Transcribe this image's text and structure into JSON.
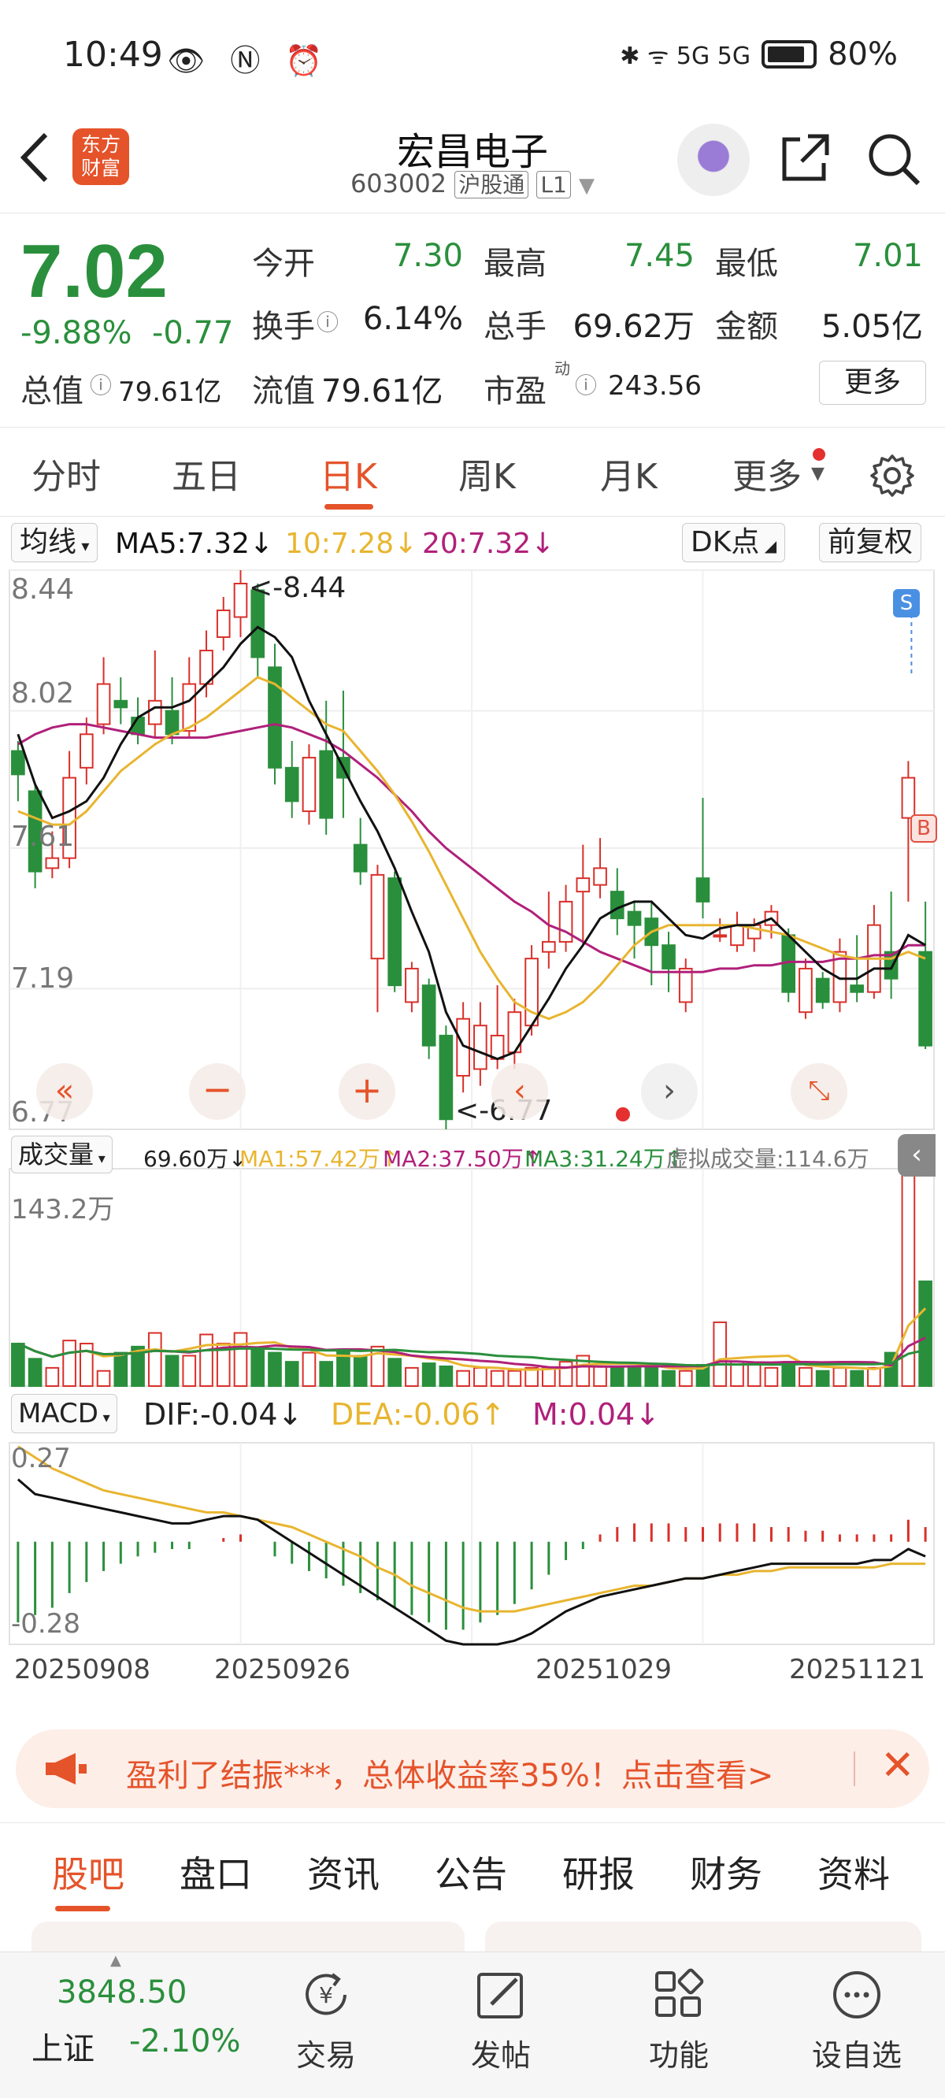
{
  "status_bar": {
    "time": "10:49",
    "left_icons": "👁 Ⓝ ⏰",
    "network": "✱ ᯤ 5G 5G",
    "battery": "80%"
  },
  "header": {
    "back_icon": "chevron-left-icon",
    "logo_text_1": "东方",
    "logo_text_2": "财富",
    "title": "宏昌电子",
    "code": "603002",
    "market_tag": "沪股通",
    "level_tag": "L1",
    "dropdown_arrow": "▼"
  },
  "quote": {
    "price": "7.02",
    "change_pct": "-9.88%",
    "change_amt": "-0.77",
    "rows": [
      [
        {
          "label": "今开",
          "value": "7.30",
          "color": "green"
        },
        {
          "label": "最高",
          "value": "7.45",
          "color": "green"
        },
        {
          "label": "最低",
          "value": "7.01",
          "color": "green"
        }
      ],
      [
        {
          "label": "换手",
          "value": "6.14%",
          "color": "dark"
        },
        {
          "label": "总手",
          "value": "69.62万",
          "color": "dark"
        },
        {
          "label": "金额",
          "value": "5.05亿",
          "color": "dark"
        }
      ],
      [
        {
          "label": "总值",
          "value": "79.61亿",
          "color": "dark"
        },
        {
          "label": "流值",
          "value": "79.61亿",
          "color": "dark"
        },
        {
          "label": "市盈",
          "value": "243.56",
          "color": "dark"
        }
      ]
    ],
    "pe_superscript": "动",
    "more_label": "更多"
  },
  "chart_tabs": [
    "分时",
    "五日",
    "日K",
    "周K",
    "月K",
    "更多"
  ],
  "chart_tabs_active": "日K",
  "ma_bar": {
    "mode_label": "均线",
    "ma5": "MA5:7.32↓",
    "ma10": "10:7.28↓",
    "ma20": "20:7.32↓",
    "dk_label": "DK点",
    "adjust_label": "前复权"
  },
  "kline": {
    "y_labels": [
      "8.44",
      "8.02",
      "7.61",
      "7.19",
      "6.77"
    ],
    "high_marker": "<-8.44",
    "low_marker": "<-6.77",
    "s_badge": "S",
    "b_badge": "B"
  },
  "volume": {
    "mode_label": "成交量",
    "vol": "69.60万↓",
    "ma1": "MA1:57.42万↑",
    "ma2": "MA2:37.50万↑",
    "ma3": "MA3:31.24万↑",
    "virtual": "虚拟成交量:114.6万",
    "max_label": "143.2万"
  },
  "macd": {
    "mode_label": "MACD",
    "dif": "DIF:-0.04↓",
    "dea": "DEA:-0.06↑",
    "m": "M:0.04↓",
    "top_label": "0.27",
    "bottom_label": "-0.28"
  },
  "x_dates": [
    "20250908",
    "20250926",
    "20251029",
    "20251121"
  ],
  "ad": {
    "text": "盈利了结振***，总体收益率35%！点击查看>",
    "icon": "megaphone-icon"
  },
  "bottom_tabs": [
    "股吧",
    "盘口",
    "资讯",
    "公告",
    "研报",
    "财务",
    "资料"
  ],
  "bottom_tabs_active": "股吧",
  "nav": {
    "index_value": "3848.50",
    "index_name": "上证",
    "index_change": "-2.10%",
    "items": [
      "交易",
      "发帖",
      "功能",
      "设自选"
    ]
  },
  "colors": {
    "up": "#d9302a",
    "down": "#2a8f3c",
    "accent": "#e5532a",
    "ma5": "#111111",
    "ma10": "#e8b530",
    "ma20": "#b0207a"
  },
  "chart_data": {
    "type": "candlestick",
    "ylim": [
      6.77,
      8.44
    ],
    "candles": [
      {
        "o": 7.9,
        "c": 7.83,
        "h": 7.93,
        "l": 7.75
      },
      {
        "o": 7.78,
        "c": 7.54,
        "h": 7.8,
        "l": 7.49
      },
      {
        "o": 7.55,
        "c": 7.58,
        "h": 7.66,
        "l": 7.52
      },
      {
        "o": 7.58,
        "c": 7.82,
        "h": 7.9,
        "l": 7.55
      },
      {
        "o": 7.85,
        "c": 7.95,
        "h": 8.0,
        "l": 7.8
      },
      {
        "o": 7.98,
        "c": 8.1,
        "h": 8.18,
        "l": 7.95
      },
      {
        "o": 8.05,
        "c": 8.03,
        "h": 8.12,
        "l": 7.98
      },
      {
        "o": 8.0,
        "c": 7.95,
        "h": 8.06,
        "l": 7.92
      },
      {
        "o": 7.98,
        "c": 8.05,
        "h": 8.2,
        "l": 7.94
      },
      {
        "o": 8.02,
        "c": 7.95,
        "h": 8.12,
        "l": 7.92
      },
      {
        "o": 7.96,
        "c": 8.1,
        "h": 8.18,
        "l": 7.94
      },
      {
        "o": 8.1,
        "c": 8.2,
        "h": 8.26,
        "l": 8.06
      },
      {
        "o": 8.24,
        "c": 8.32,
        "h": 8.36,
        "l": 8.2
      },
      {
        "o": 8.3,
        "c": 8.4,
        "h": 8.44,
        "l": 8.24
      },
      {
        "o": 8.38,
        "c": 8.18,
        "h": 8.4,
        "l": 8.12
      },
      {
        "o": 8.15,
        "c": 7.85,
        "h": 8.22,
        "l": 7.8
      },
      {
        "o": 7.85,
        "c": 7.75,
        "h": 7.93,
        "l": 7.7
      },
      {
        "o": 7.72,
        "c": 7.88,
        "h": 7.92,
        "l": 7.68
      },
      {
        "o": 7.9,
        "c": 7.7,
        "h": 8.05,
        "l": 7.65
      },
      {
        "o": 7.88,
        "c": 7.82,
        "h": 8.08,
        "l": 7.7
      },
      {
        "o": 7.62,
        "c": 7.54,
        "h": 7.7,
        "l": 7.5
      },
      {
        "o": 7.28,
        "c": 7.53,
        "h": 7.56,
        "l": 7.12
      },
      {
        "o": 7.52,
        "c": 7.2,
        "h": 7.54,
        "l": 7.18
      },
      {
        "o": 7.15,
        "c": 7.25,
        "h": 7.27,
        "l": 7.12
      },
      {
        "o": 7.2,
        "c": 7.02,
        "h": 7.22,
        "l": 6.98
      },
      {
        "o": 7.05,
        "c": 6.8,
        "h": 7.08,
        "l": 6.77
      },
      {
        "o": 6.93,
        "c": 7.1,
        "h": 7.15,
        "l": 6.88
      },
      {
        "o": 6.95,
        "c": 7.08,
        "h": 7.15,
        "l": 6.9
      },
      {
        "o": 6.98,
        "c": 7.05,
        "h": 7.2,
        "l": 6.95
      },
      {
        "o": 7.0,
        "c": 7.12,
        "h": 7.16,
        "l": 6.95
      },
      {
        "o": 7.08,
        "c": 7.28,
        "h": 7.32,
        "l": 7.05
      },
      {
        "o": 7.3,
        "c": 7.33,
        "h": 7.48,
        "l": 7.25
      },
      {
        "o": 7.33,
        "c": 7.45,
        "h": 7.5,
        "l": 7.3
      },
      {
        "o": 7.48,
        "c": 7.52,
        "h": 7.62,
        "l": 7.32
      },
      {
        "o": 7.5,
        "c": 7.55,
        "h": 7.64,
        "l": 7.46
      },
      {
        "o": 7.48,
        "c": 7.4,
        "h": 7.55,
        "l": 7.35
      },
      {
        "o": 7.42,
        "c": 7.38,
        "h": 7.45,
        "l": 7.28
      },
      {
        "o": 7.4,
        "c": 7.32,
        "h": 7.45,
        "l": 7.2
      },
      {
        "o": 7.32,
        "c": 7.25,
        "h": 7.36,
        "l": 7.18
      },
      {
        "o": 7.15,
        "c": 7.25,
        "h": 7.28,
        "l": 7.12
      },
      {
        "o": 7.52,
        "c": 7.45,
        "h": 7.76,
        "l": 7.4
      },
      {
        "o": 7.35,
        "c": 7.35,
        "h": 7.4,
        "l": 7.33
      },
      {
        "o": 7.32,
        "c": 7.38,
        "h": 7.42,
        "l": 7.3
      },
      {
        "o": 7.34,
        "c": 7.38,
        "h": 7.4,
        "l": 7.3
      },
      {
        "o": 7.38,
        "c": 7.42,
        "h": 7.44,
        "l": 7.34
      },
      {
        "o": 7.35,
        "c": 7.18,
        "h": 7.37,
        "l": 7.15
      },
      {
        "o": 7.12,
        "c": 7.25,
        "h": 7.28,
        "l": 7.1
      },
      {
        "o": 7.22,
        "c": 7.15,
        "h": 7.24,
        "l": 7.13
      },
      {
        "o": 7.15,
        "c": 7.3,
        "h": 7.34,
        "l": 7.12
      },
      {
        "o": 7.2,
        "c": 7.18,
        "h": 7.35,
        "l": 7.15
      },
      {
        "o": 7.18,
        "c": 7.38,
        "h": 7.44,
        "l": 7.16
      },
      {
        "o": 7.3,
        "c": 7.22,
        "h": 7.48,
        "l": 7.16
      },
      {
        "o": 7.7,
        "c": 7.82,
        "h": 7.87,
        "l": 7.45
      },
      {
        "o": 7.3,
        "c": 7.02,
        "h": 7.45,
        "l": 7.01
      }
    ],
    "ma5": [
      7.95,
      7.8,
      7.7,
      7.72,
      7.75,
      7.82,
      7.92,
      8.0,
      8.03,
      8.03,
      8.05,
      8.1,
      8.15,
      8.22,
      8.27,
      8.24,
      8.18,
      8.05,
      7.95,
      7.85,
      7.75,
      7.66,
      7.55,
      7.42,
      7.3,
      7.12,
      7.02,
      7.0,
      6.98,
      7.0,
      7.08,
      7.16,
      7.25,
      7.32,
      7.4,
      7.43,
      7.45,
      7.45,
      7.4,
      7.35,
      7.34,
      7.37,
      7.38,
      7.38,
      7.4,
      7.35,
      7.3,
      7.25,
      7.22,
      7.22,
      7.25,
      7.25,
      7.35,
      7.32
    ],
    "ma10": [
      7.72,
      7.7,
      7.68,
      7.68,
      7.72,
      7.78,
      7.84,
      7.88,
      7.92,
      7.95,
      7.97,
      8.0,
      8.04,
      8.08,
      8.12,
      8.1,
      8.06,
      8.02,
      7.98,
      7.96,
      7.9,
      7.84,
      7.77,
      7.69,
      7.6,
      7.5,
      7.4,
      7.3,
      7.22,
      7.15,
      7.12,
      7.1,
      7.12,
      7.15,
      7.2,
      7.26,
      7.32,
      7.36,
      7.38,
      7.38,
      7.38,
      7.38,
      7.38,
      7.37,
      7.36,
      7.35,
      7.33,
      7.31,
      7.29,
      7.28,
      7.28,
      7.28,
      7.3,
      7.28
    ],
    "ma20": [
      7.92,
      7.95,
      7.97,
      7.98,
      7.98,
      7.97,
      7.96,
      7.95,
      7.94,
      7.94,
      7.94,
      7.94,
      7.95,
      7.96,
      7.97,
      7.98,
      7.97,
      7.95,
      7.93,
      7.9,
      7.86,
      7.82,
      7.77,
      7.72,
      7.66,
      7.61,
      7.57,
      7.53,
      7.49,
      7.45,
      7.42,
      7.38,
      7.36,
      7.33,
      7.3,
      7.28,
      7.26,
      7.24,
      7.24,
      7.24,
      7.24,
      7.25,
      7.25,
      7.26,
      7.26,
      7.27,
      7.27,
      7.27,
      7.28,
      7.28,
      7.29,
      7.29,
      7.32,
      7.32
    ],
    "volume": [
      28,
      18,
      12,
      30,
      28,
      10,
      22,
      26,
      35,
      20,
      20,
      34,
      28,
      35,
      25,
      22,
      16,
      22,
      16,
      24,
      20,
      26,
      18,
      12,
      15,
      13,
      10,
      12,
      10,
      10,
      12,
      12,
      16,
      20,
      13,
      13,
      12,
      12,
      10,
      10,
      14,
      42,
      16,
      14,
      12,
      16,
      12,
      10,
      12,
      10,
      12,
      22,
      143,
      69
    ],
    "volume_ylim": [
      0,
      143.2
    ],
    "macd_hist": [
      -0.22,
      -0.2,
      -0.18,
      -0.14,
      -0.11,
      -0.08,
      -0.06,
      -0.04,
      -0.03,
      -0.02,
      -0.02,
      0.0,
      0.01,
      0.02,
      0.0,
      -0.04,
      -0.06,
      -0.08,
      -0.1,
      -0.12,
      -0.14,
      -0.16,
      -0.18,
      -0.2,
      -0.22,
      -0.24,
      -0.24,
      -0.22,
      -0.2,
      -0.17,
      -0.13,
      -0.09,
      -0.05,
      -0.02,
      0.02,
      0.04,
      0.05,
      0.05,
      0.05,
      0.04,
      0.04,
      0.05,
      0.05,
      0.05,
      0.04,
      0.04,
      0.03,
      0.03,
      0.02,
      0.02,
      0.02,
      0.02,
      0.06,
      0.04
    ],
    "dif": [
      0.17,
      0.13,
      0.12,
      0.11,
      0.1,
      0.09,
      0.08,
      0.07,
      0.06,
      0.05,
      0.05,
      0.06,
      0.07,
      0.07,
      0.06,
      0.03,
      0.0,
      -0.03,
      -0.06,
      -0.09,
      -0.12,
      -0.15,
      -0.18,
      -0.21,
      -0.24,
      -0.27,
      -0.28,
      -0.28,
      -0.28,
      -0.27,
      -0.25,
      -0.22,
      -0.19,
      -0.17,
      -0.15,
      -0.14,
      -0.13,
      -0.12,
      -0.11,
      -0.1,
      -0.1,
      -0.09,
      -0.08,
      -0.07,
      -0.06,
      -0.06,
      -0.06,
      -0.06,
      -0.06,
      -0.06,
      -0.05,
      -0.05,
      -0.02,
      -0.04
    ],
    "dea": [
      0.26,
      0.23,
      0.2,
      0.18,
      0.16,
      0.14,
      0.13,
      0.12,
      0.11,
      0.1,
      0.09,
      0.08,
      0.08,
      0.07,
      0.06,
      0.05,
      0.04,
      0.02,
      0.0,
      -0.02,
      -0.04,
      -0.07,
      -0.09,
      -0.12,
      -0.14,
      -0.16,
      -0.18,
      -0.19,
      -0.19,
      -0.19,
      -0.18,
      -0.17,
      -0.16,
      -0.15,
      -0.14,
      -0.13,
      -0.12,
      -0.12,
      -0.11,
      -0.1,
      -0.1,
      -0.09,
      -0.09,
      -0.08,
      -0.08,
      -0.07,
      -0.07,
      -0.07,
      -0.07,
      -0.07,
      -0.07,
      -0.06,
      -0.06,
      -0.06
    ],
    "macd_ylim": [
      -0.28,
      0.27
    ]
  }
}
